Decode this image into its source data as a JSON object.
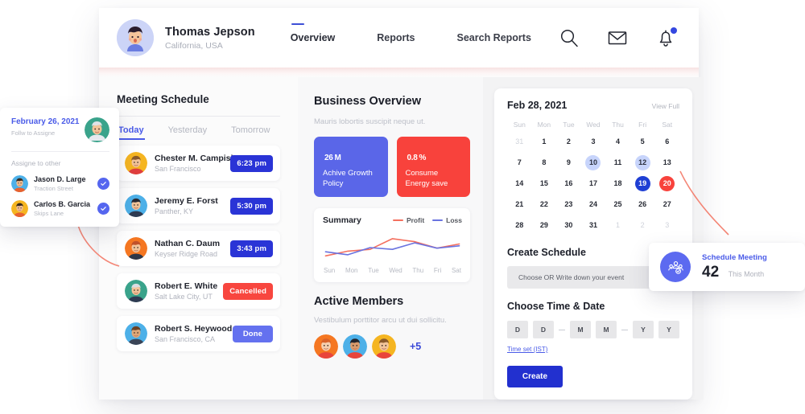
{
  "header": {
    "user_name": "Thomas Jepson",
    "user_location": "California, USA",
    "nav": [
      {
        "label": "Overview",
        "active": true
      },
      {
        "label": "Reports",
        "active": false
      },
      {
        "label": "Search Reports",
        "active": false
      }
    ],
    "icons": [
      "search-icon",
      "mail-icon",
      "bell-icon"
    ]
  },
  "meeting_schedule": {
    "title": "Meeting Schedule",
    "tabs": [
      {
        "label": "Today",
        "active": true
      },
      {
        "label": "Yesterday",
        "active": false
      },
      {
        "label": "Tomorrow",
        "active": false
      }
    ],
    "items": [
      {
        "name": "Chester M. Campisi",
        "place": "San Francisco",
        "badge": "6:23 pm",
        "badge_type": "time",
        "avatar_bg": "#f5b521",
        "hair": "#8a5a2b",
        "skin": "#f2c49a",
        "shirt": "#e03e3e"
      },
      {
        "name": "Jeremy E. Forst",
        "place": "Panther, KY",
        "badge": "5:30 pm",
        "badge_type": "time",
        "avatar_bg": "#4db0e8",
        "hair": "#2a2a33",
        "skin": "#f2c49a",
        "shirt": "#2e3b52"
      },
      {
        "name": "Nathan C. Daum",
        "place": "Keyser Ridge Road",
        "badge": "3:43 pm",
        "badge_type": "time",
        "avatar_bg": "#f57722",
        "hair": "#c0522a",
        "skin": "#f2c49a",
        "shirt": "#2f3748"
      },
      {
        "name": "Robert E. White",
        "place": "Salt Lake City, UT",
        "badge": "Cancelled",
        "badge_type": "cancel",
        "avatar_bg": "#3aa38b",
        "hair": "#d9dde2",
        "skin": "#f2c49a",
        "shirt": "#2e3b52"
      },
      {
        "name": "Robert S. Heywood",
        "place": "San Francisco, CA",
        "badge": "Done",
        "badge_type": "done",
        "avatar_bg": "#4db0e8",
        "hair": "#6b4226",
        "skin": "#e0a878",
        "shirt": "#3a4456"
      }
    ]
  },
  "business_overview": {
    "title": "Business Overview",
    "subtitle": "Mauris lobortis suscipit neque ut.",
    "stats": [
      {
        "value": "26",
        "unit": "M",
        "caption": "Achive Growth Policy",
        "color": "#5a66e8"
      },
      {
        "value": "0.8",
        "unit": "%",
        "caption": "Consume Energy save",
        "color": "#f8423c"
      }
    ]
  },
  "chart_data": {
    "type": "line",
    "title": "Summary",
    "xlabel": "",
    "ylabel": "",
    "categories": [
      "Sun",
      "Mon",
      "Tue",
      "Wed",
      "Thu",
      "Fri",
      "Sat"
    ],
    "ylim": [
      0,
      100
    ],
    "grid": false,
    "legend_position": "top-right",
    "series": [
      {
        "name": "Profit",
        "color": "#f4705f",
        "values": [
          18,
          34,
          40,
          76,
          66,
          44,
          58
        ]
      },
      {
        "name": "Loss",
        "color": "#6a73e0",
        "values": [
          32,
          22,
          46,
          40,
          62,
          44,
          52
        ]
      }
    ]
  },
  "active_members": {
    "title": "Active Members",
    "subtitle": "Vestibulum porttitor arcu ut dui sollicitu.",
    "more_count": "+5",
    "avatars": [
      {
        "bg": "#f57722",
        "hair": "#d9632a",
        "skin": "#f6cfae"
      },
      {
        "bg": "#4db0e8",
        "hair": "#24252c",
        "skin": "#d99b6c"
      },
      {
        "bg": "#f5b521",
        "hair": "#8a5a2b",
        "skin": "#f2c49a"
      }
    ]
  },
  "calendar": {
    "header_date": "Feb 28, 2021",
    "view_full_label": "View Full",
    "day_names": [
      "Sun",
      "Mon",
      "Tue",
      "Wed",
      "Thu",
      "Fri",
      "Sat"
    ],
    "cells": [
      {
        "d": "31",
        "state": "dim"
      },
      {
        "d": "1",
        "state": ""
      },
      {
        "d": "2",
        "state": ""
      },
      {
        "d": "3",
        "state": ""
      },
      {
        "d": "4",
        "state": ""
      },
      {
        "d": "5",
        "state": ""
      },
      {
        "d": "6",
        "state": ""
      },
      {
        "d": "7",
        "state": ""
      },
      {
        "d": "8",
        "state": ""
      },
      {
        "d": "9",
        "state": ""
      },
      {
        "d": "10",
        "state": "light"
      },
      {
        "d": "11",
        "state": ""
      },
      {
        "d": "12",
        "state": "light"
      },
      {
        "d": "13",
        "state": ""
      },
      {
        "d": "14",
        "state": ""
      },
      {
        "d": "15",
        "state": ""
      },
      {
        "d": "16",
        "state": ""
      },
      {
        "d": "17",
        "state": ""
      },
      {
        "d": "18",
        "state": ""
      },
      {
        "d": "19",
        "state": "solid"
      },
      {
        "d": "20",
        "state": "red"
      },
      {
        "d": "21",
        "state": ""
      },
      {
        "d": "22",
        "state": ""
      },
      {
        "d": "23",
        "state": ""
      },
      {
        "d": "24",
        "state": ""
      },
      {
        "d": "25",
        "state": ""
      },
      {
        "d": "26",
        "state": ""
      },
      {
        "d": "27",
        "state": ""
      },
      {
        "d": "28",
        "state": ""
      },
      {
        "d": "29",
        "state": ""
      },
      {
        "d": "30",
        "state": ""
      },
      {
        "d": "31",
        "state": ""
      },
      {
        "d": "1",
        "state": "dim"
      },
      {
        "d": "2",
        "state": "dim"
      },
      {
        "d": "3",
        "state": "dim"
      }
    ]
  },
  "create_schedule": {
    "title": "Create Schedule",
    "event_placeholder": "Choose OR Write down your event",
    "event_value": "",
    "time_date_title": "Choose Time & Date",
    "date_boxes": [
      "D",
      "D",
      "M",
      "M",
      "Y",
      "Y"
    ],
    "time_set_label": "Time set (IST)",
    "create_button": "Create"
  },
  "assign_card": {
    "date": "February 26, 2021",
    "subtitle": "Follw to Assigne",
    "section_label": "Assigne to other",
    "people": [
      {
        "name": "Jason D. Large",
        "place": "Traction Street",
        "checked": true,
        "bg": "#4db0e8",
        "hair": "#3a2a1e",
        "skin": "#f0bd92"
      },
      {
        "name": "Carlos B. Garcia",
        "place": "Skips Lane",
        "checked": true,
        "bg": "#f5b521",
        "hair": "#3a2a1e",
        "skin": "#f0bd92"
      }
    ],
    "avatar_bg": "#3aa38b"
  },
  "schedule_meeting_card": {
    "title": "Schedule Meeting",
    "count": "42",
    "period": "This Month",
    "icon": "group-meeting-icon"
  },
  "colors": {
    "accent_blue": "#4a5be8",
    "deep_blue": "#2230cf",
    "red": "#f8423c",
    "page_bg": "#ffffff",
    "connector": "#f2715e"
  }
}
